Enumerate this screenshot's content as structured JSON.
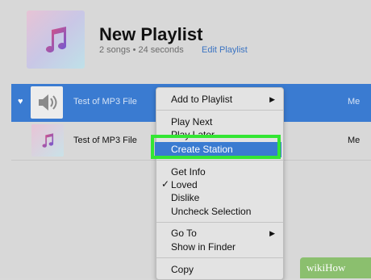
{
  "playlist": {
    "title": "New Playlist",
    "subtitle": "2 songs • 24 seconds",
    "edit_label": "Edit Playlist"
  },
  "songs": [
    {
      "name": "Test of MP3 File",
      "artist": "Me",
      "loved": true,
      "selected": true
    },
    {
      "name": "Test of MP3 File",
      "artist": "Me",
      "loved": false,
      "selected": false
    }
  ],
  "context_menu": {
    "add_to_playlist": "Add to Playlist",
    "play_next": "Play Next",
    "play_later": "Play Later",
    "create_station": "Create Station",
    "get_info": "Get Info",
    "loved": "Loved",
    "dislike": "Dislike",
    "uncheck_selection": "Uncheck Selection",
    "go_to": "Go To",
    "show_in_finder": "Show in Finder",
    "copy": "Copy",
    "highlighted_item": "Create Station"
  },
  "watermark": {
    "text": "wikiHow"
  },
  "colors": {
    "accent": "#3a7bd1",
    "highlight_box": "#33e633",
    "background": "#d8d8d8"
  },
  "icons": {
    "heart": "heart-icon",
    "speaker": "speaker-icon",
    "music_note": "music-note-icon",
    "submenu": "chevron-right-icon",
    "check": "checkmark-icon"
  }
}
